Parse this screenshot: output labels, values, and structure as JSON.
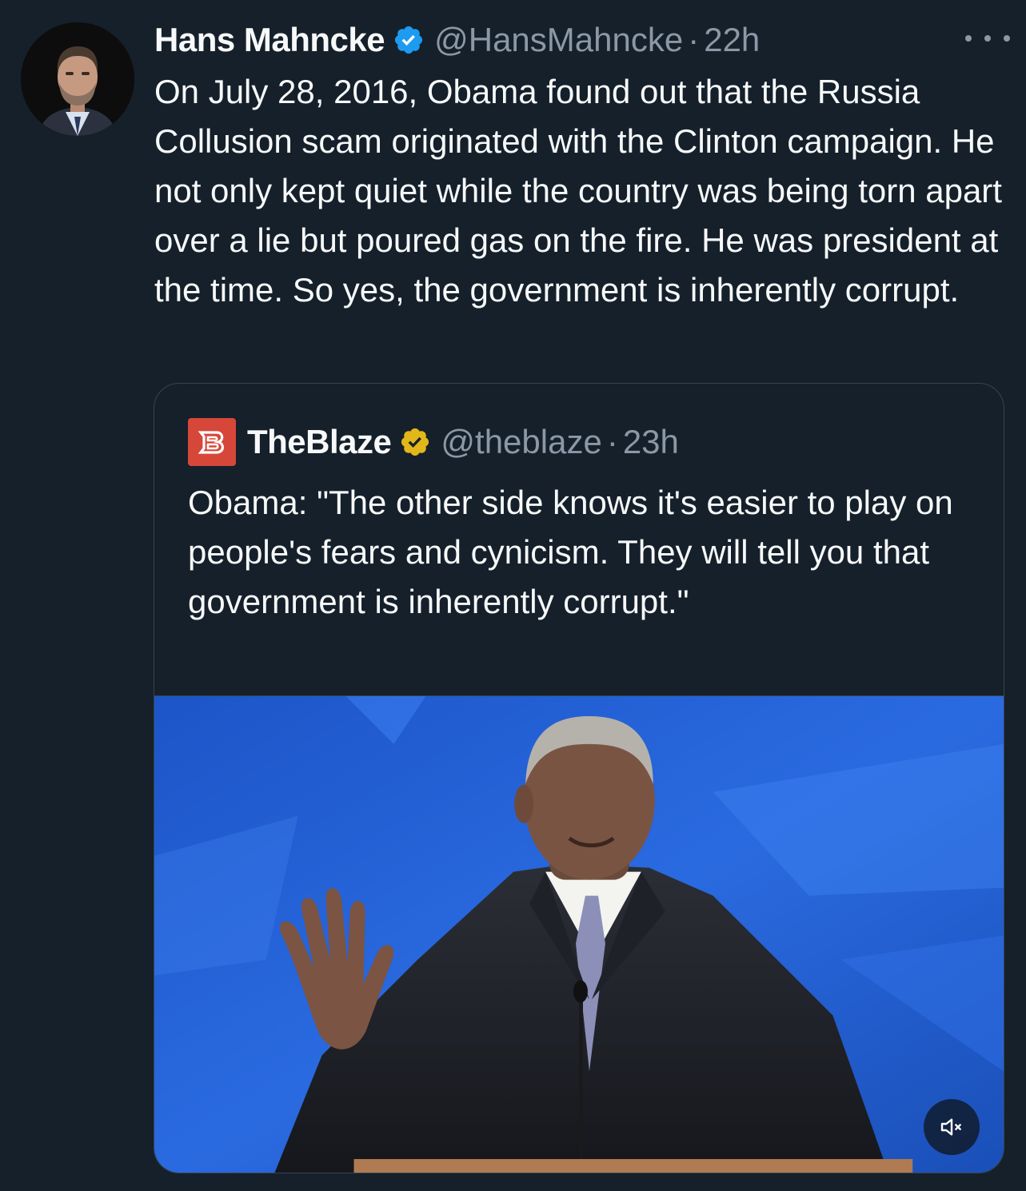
{
  "tweet": {
    "author": {
      "name": "Hans Mahncke",
      "handle": "@HansMahncke",
      "verified_color": "#1d9bf0"
    },
    "separator": "·",
    "time": "22h",
    "text": "On July 28, 2016, Obama found out that the Russia Collusion scam originated with the Clinton campaign. He not only kept quiet while the country was being torn apart over a lie but poured gas on the fire. He was president at the time. So yes, the government is inherently corrupt.",
    "more_icon": "ellipsis-icon"
  },
  "quote": {
    "author": {
      "name": "TheBlaze",
      "handle": "@theblaze",
      "verified_color": "#e2b719",
      "logo_color": "#d6473a"
    },
    "separator": "·",
    "time": "23h",
    "text": "Obama: \"The other side knows it's easier to play on people's fears and cynicism. They will tell you that government is inherently corrupt.\"",
    "media": {
      "type": "video",
      "muted": true,
      "mute_icon": "speaker-muted-icon"
    }
  },
  "theme": {
    "background": "#15202b",
    "text": "#f7f9f9",
    "secondary": "#8b98a5",
    "border": "#38444d"
  }
}
